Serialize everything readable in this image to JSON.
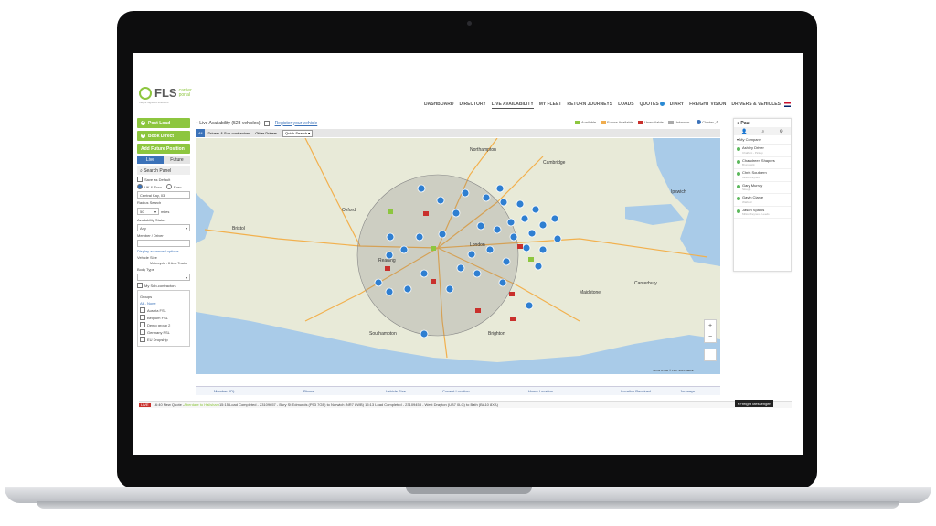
{
  "app": {
    "logo_text": "FLS",
    "logo_sub": "carrier portal",
    "logo_tag": "freight logistics solutions"
  },
  "nav": [
    {
      "label": "DASHBOARD",
      "active": false
    },
    {
      "label": "DIRECTORY",
      "active": false
    },
    {
      "label": "LIVE AVAILABILITY",
      "active": true
    },
    {
      "label": "MY FLEET",
      "active": false
    },
    {
      "label": "RETURN JOURNEYS",
      "active": false
    },
    {
      "label": "LOADS",
      "active": false
    },
    {
      "label": "QUOTES",
      "active": false,
      "badge": true
    },
    {
      "label": "DIARY",
      "active": false
    },
    {
      "label": "FREIGHT VISION",
      "active": false
    },
    {
      "label": "DRIVERS & VEHICLES",
      "active": false
    }
  ],
  "left_panel": {
    "post_load": "Post Load",
    "book_direct": "Book Direct",
    "add_future": "Add Future Position",
    "live": "Live",
    "future": "Future",
    "search_panel": "Search Panel",
    "save_default": "Save as Default",
    "uk_euro": "UK & Euro",
    "euro": "Euro",
    "location_value": "Central Kay, 03",
    "radius_label": "Radius Search",
    "radius_value": "50",
    "radius_unit": "miles",
    "availability_label": "Availability Status",
    "availability_value": "Any",
    "member_label": "Member / Driver",
    "display_link": "Display advanced options",
    "vehicle_size_label": "Vehicle Size",
    "vehicle_size_value": "Motorcycle - 8 Axle Tractor",
    "body_type_label": "Body Type",
    "my_subcontractors": "My Sub-contractors",
    "groups_label": "Groups",
    "groups": [
      "All - None",
      "Austria FSL",
      "Belgium FSL",
      "Demo group 2",
      "Germany FSL",
      "EU Dropship"
    ]
  },
  "map_header": {
    "title": "Live Availability (528 vehicles)",
    "register": "Register your vehicle",
    "cluster": "Cluster",
    "legend": [
      {
        "label": "Available",
        "color": "#8dc63f"
      },
      {
        "label": "Future Available",
        "color": "#f0ad4e"
      },
      {
        "label": "Unavailable",
        "color": "#c9302c"
      },
      {
        "label": "Unknown",
        "color": "#aaaaaa"
      }
    ],
    "tabs": [
      "All",
      "Drivers & Sub-contractors",
      "Other Drivers"
    ],
    "quick_search": "Quick Search"
  },
  "map": {
    "labels": [
      "Northampton",
      "Cambridge",
      "Bristol",
      "London",
      "Reading",
      "Oxford",
      "Southampton",
      "Brighton",
      "Canterbury",
      "Ipswich",
      "Maidstone"
    ],
    "attribution": "Terms of use   © 1987-2020 HERE"
  },
  "table": {
    "columns": [
      "Member (ID)",
      "Phone",
      "Vehicle Size",
      "Current Location",
      "Home Location",
      "Location Received",
      "Journeys"
    ]
  },
  "ticker": {
    "badge": "LIVE",
    "text1": "16:40 New Quote - ",
    "text1_green": "Aberdare to Hailsham",
    "text2": "  15:15 Load Completed - 23109657 - Bury St Edmunds (P53 7GB) to Norwich (NR7 8WB)   15:13 Load Completed - 23109453 - West Drayton (UB7 0LG) to Bath (BA10 8XA)"
  },
  "freight_messenger": "Freight Messenger",
  "right_panel": {
    "title": "Paul",
    "group": "My Company",
    "drivers": [
      {
        "name": "Ashley Driver",
        "sub": "Chalfont - Pickup"
      },
      {
        "name": "Chandreen Shapers",
        "sub": "Brunswick"
      },
      {
        "name": "Chris Southern",
        "sub": "Milton Keynes"
      },
      {
        "name": "Gary Murray",
        "sub": "Slough"
      },
      {
        "name": "Gavin Clarke",
        "sub": "Watford"
      },
      {
        "name": "Jason Sparks",
        "sub": "Milton Keynes - Leeds"
      }
    ]
  }
}
